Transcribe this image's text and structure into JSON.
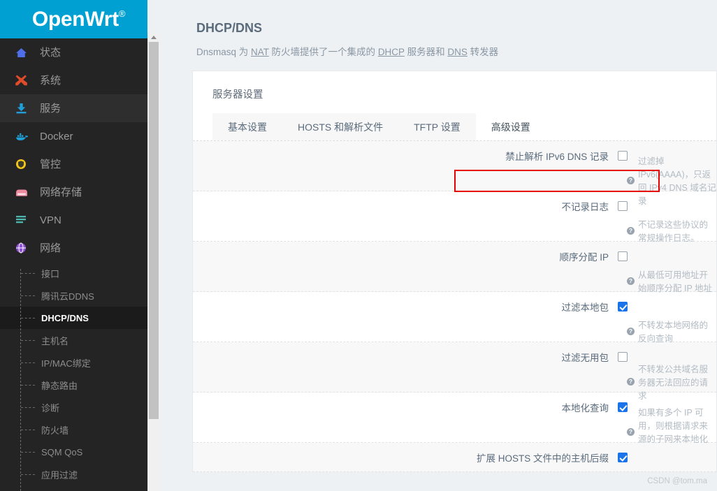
{
  "brand": {
    "name": "OpenWrt",
    "reg": "®"
  },
  "sidebar": {
    "items": [
      {
        "label": "状态",
        "icon": "home-icon",
        "active": false
      },
      {
        "label": "系统",
        "icon": "tools-icon",
        "active": false
      },
      {
        "label": "服务",
        "icon": "download-icon",
        "active": true
      },
      {
        "label": "Docker",
        "icon": "docker-whale-icon",
        "active": false
      },
      {
        "label": "管控",
        "icon": "shield-icon",
        "active": false
      },
      {
        "label": "网络存储",
        "icon": "drive-icon",
        "active": false
      },
      {
        "label": "VPN",
        "icon": "lines-icon",
        "active": false
      },
      {
        "label": "网络",
        "icon": "globe-icon",
        "active": false
      }
    ],
    "subitems": [
      {
        "label": "接口",
        "active": false
      },
      {
        "label": "腾讯云DDNS",
        "active": false
      },
      {
        "label": "DHCP/DNS",
        "active": true
      },
      {
        "label": "主机名",
        "active": false
      },
      {
        "label": "IP/MAC绑定",
        "active": false
      },
      {
        "label": "静态路由",
        "active": false
      },
      {
        "label": "诊断",
        "active": false
      },
      {
        "label": "防火墙",
        "active": false
      },
      {
        "label": "SQM QoS",
        "active": false
      },
      {
        "label": "应用过滤",
        "active": false
      }
    ]
  },
  "page": {
    "title": "DHCP/DNS",
    "desc_prefix": "Dnsmasq 为 ",
    "desc_link1": "NAT",
    "desc_mid1": " 防火墙提供了一个集成的 ",
    "desc_link2": "DHCP",
    "desc_mid2": " 服务器和 ",
    "desc_link3": "DNS",
    "desc_suffix": " 转发器"
  },
  "panel": {
    "title": "服务器设置",
    "tabs": [
      {
        "label": "基本设置",
        "active": false
      },
      {
        "label": "HOSTS 和解析文件",
        "active": false
      },
      {
        "label": "TFTP 设置",
        "active": false
      },
      {
        "label": "高级设置",
        "active": true
      }
    ],
    "rows": [
      {
        "label": "禁止解析 IPv6 DNS 记录",
        "checked": false,
        "hint": "过滤掉 IPv6(AAAA)，只返回 IPv4 DNS 域名记录",
        "highlighted": true
      },
      {
        "label": "不记录日志",
        "checked": false,
        "hint": "不记录这些协议的常规操作日志。",
        "highlighted": false
      },
      {
        "label": "顺序分配 IP",
        "checked": false,
        "hint": "从最低可用地址开始顺序分配 IP 地址",
        "highlighted": false
      },
      {
        "label": "过滤本地包",
        "checked": true,
        "hint": "不转发本地网络的反向查询",
        "highlighted": false
      },
      {
        "label": "过滤无用包",
        "checked": false,
        "hint": "不转发公共域名服务器无法回应的请求",
        "highlighted": false
      },
      {
        "label": "本地化查询",
        "checked": true,
        "hint": "如果有多个 IP 可用，则根据请求来源的子网来本地化主机名",
        "highlighted": false
      },
      {
        "label": "扩展 HOSTS 文件中的主机后缀",
        "checked": true,
        "hint": "",
        "highlighted": false
      }
    ]
  },
  "watermark": "CSDN @tom.ma",
  "colors": {
    "brand": "#00a0d2",
    "sidebar": "#242424",
    "accent_checkbox": "#1a73e8",
    "highlight": "#e60000",
    "page_bg": "#eef1f4"
  }
}
